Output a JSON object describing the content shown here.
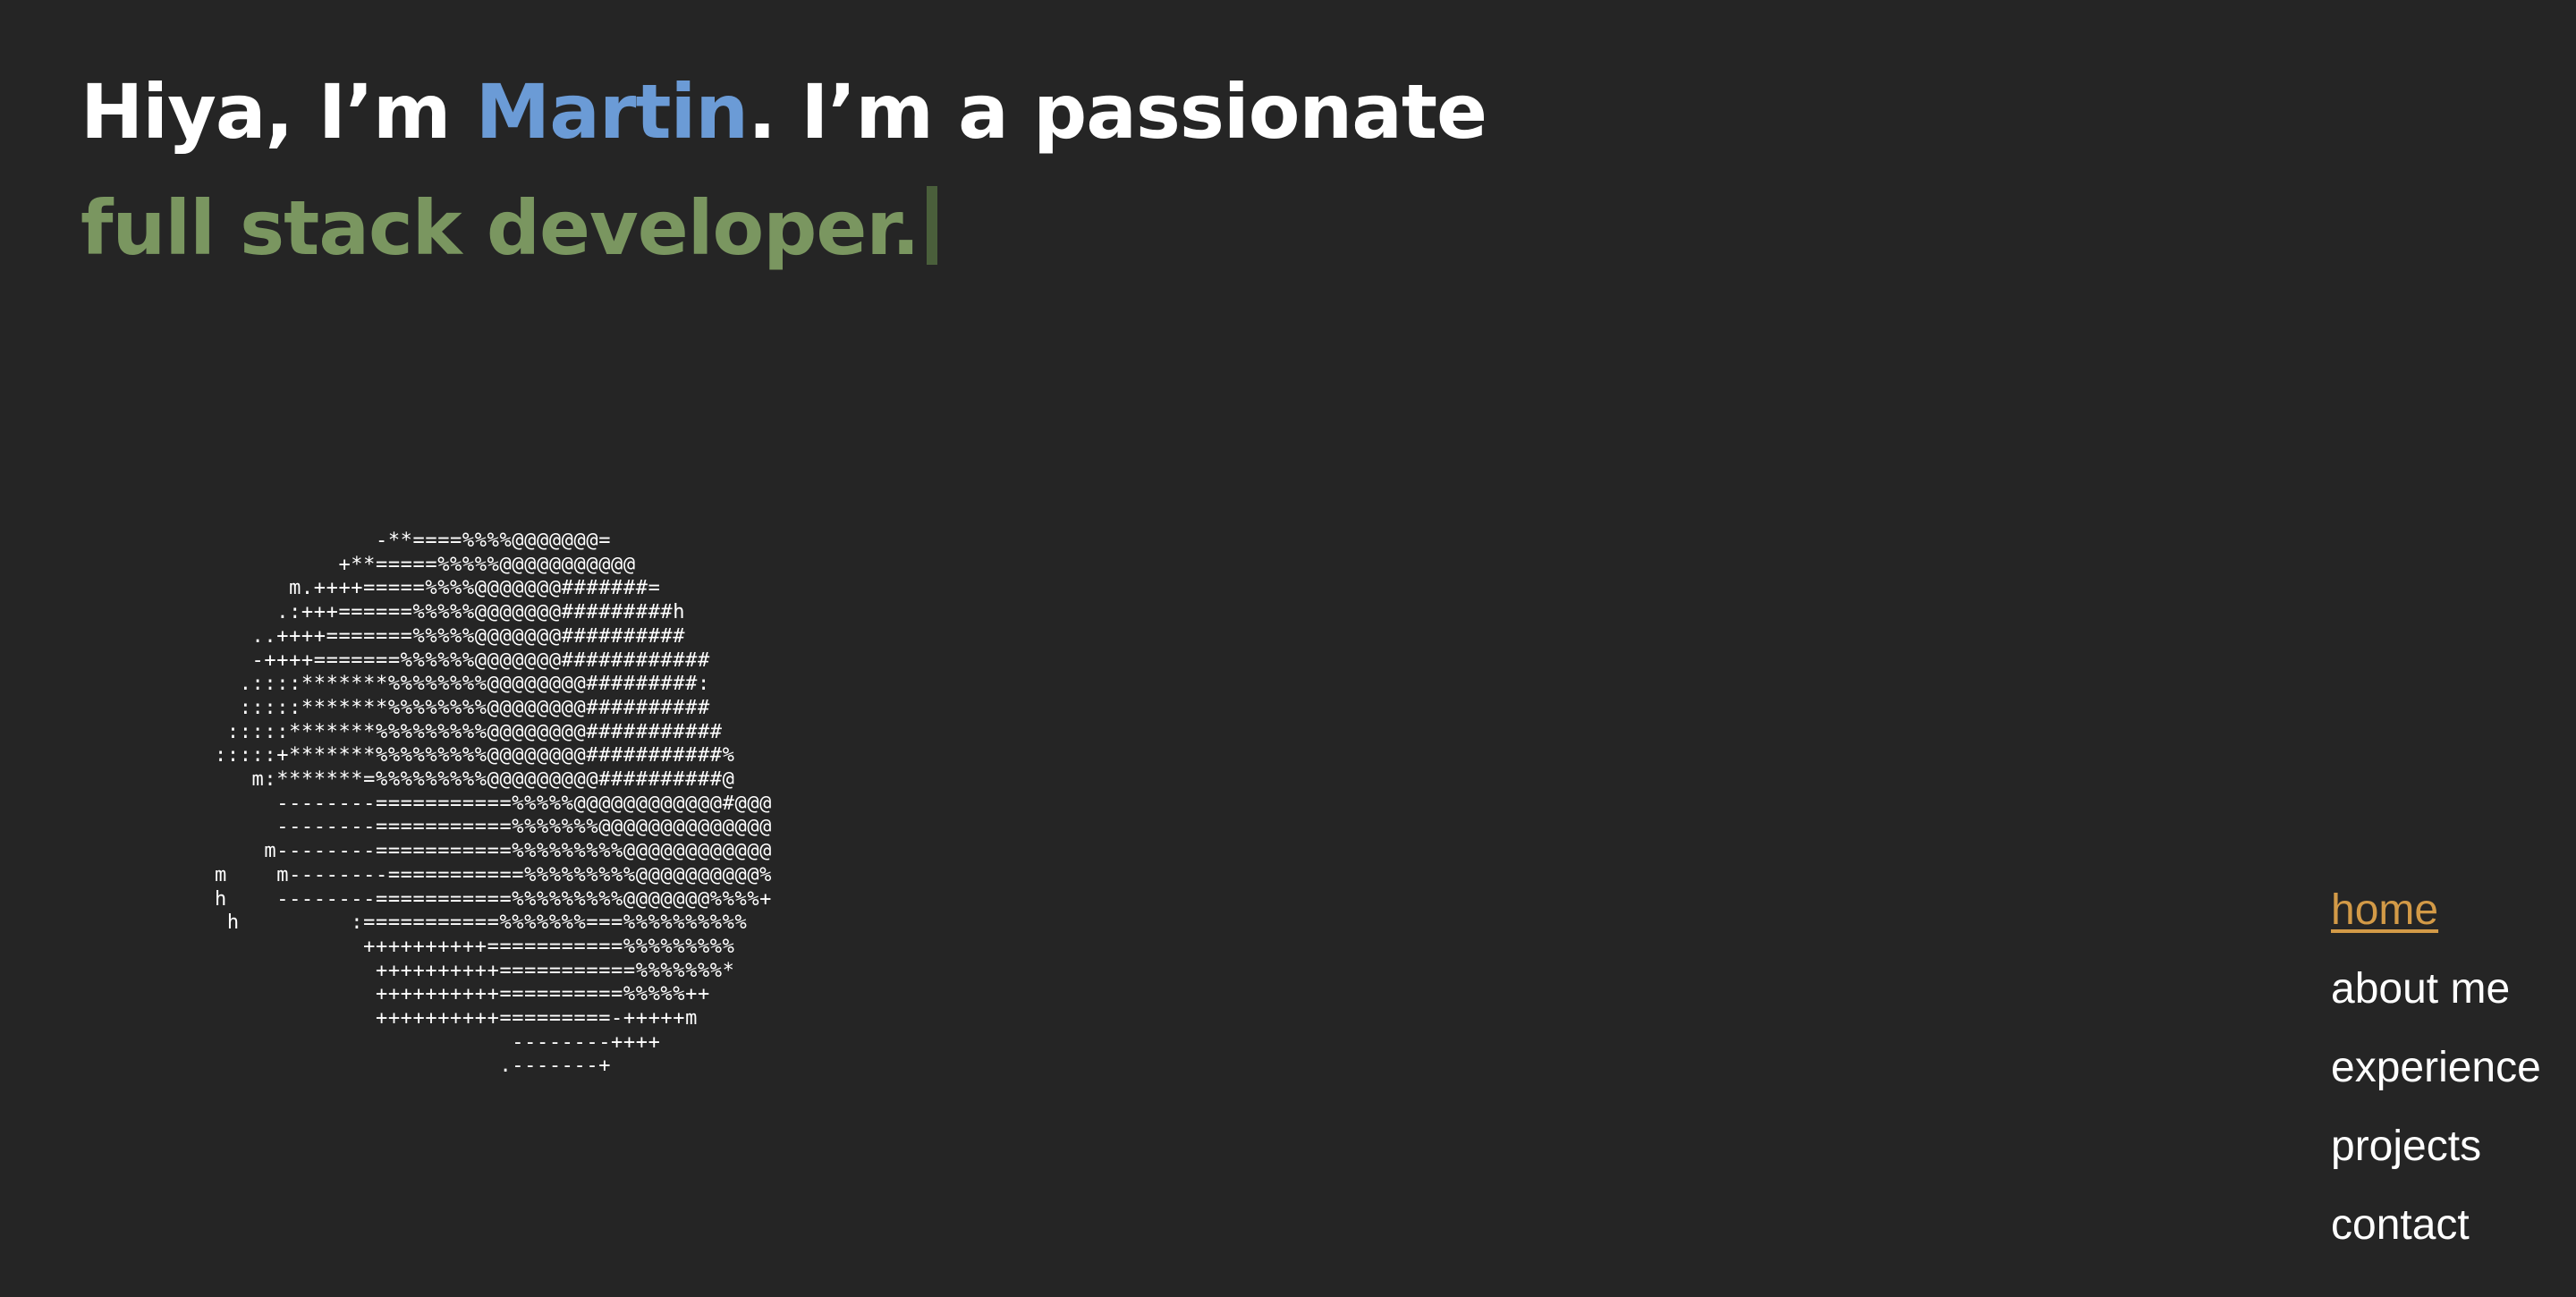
{
  "hero": {
    "line1_prefix": "Hiya, I’m ",
    "name": "Martin",
    "line1_suffix": ". I’m a passionate",
    "role": "full stack developer."
  },
  "ascii_art": "             -**====%%%%@@@@@@@=\n          +**=====%%%%%@@@@@@@@@@@\n      m.++++=====%%%%@@@@@@@#######=\n     .:+++======%%%%%@@@@@@@#########h\n   ..++++=======%%%%%@@@@@@@##########\n   -++++=======%%%%%%@@@@@@@############\n  .::::*******%%%%%%%%@@@@@@@@#########:\n  :::::*******%%%%%%%%@@@@@@@@##########\n :::::*******%%%%%%%%%@@@@@@@@###########\n:::::+*******%%%%%%%%%@@@@@@@@###########%\n   m:*******=%%%%%%%%%@@@@@@@@@##########@\n     --------===========%%%%%@@@@@@@@@@@@#@@@\n     --------===========%%%%%%%@@@@@@@@@@@@@@\n    m--------===========%%%%%%%%%@@@@@@@@@@@@\nm    m--------===========%%%%%%%%%@@@@@@@@@@%\nh    --------===========%%%%%%%%%@@@@@@@%%%%+\n h         :===========%%%%%%%===%%%%%%%%%%\n            ++++++++++===========%%%%%%%%%\n             ++++++++++===========%%%%%%%*\n             ++++++++++==========%%%%%++\n             ++++++++++=========-+++++m\n                        --------++++\n                       .-------+",
  "nav": {
    "items": [
      {
        "label": "home",
        "active": true
      },
      {
        "label": "about me",
        "active": false
      },
      {
        "label": "experience",
        "active": false
      },
      {
        "label": "projects",
        "active": false
      },
      {
        "label": "contact",
        "active": false
      }
    ]
  },
  "colors": {
    "background": "#252525",
    "text": "#ffffff",
    "name_accent": "#6b9bd6",
    "role_accent": "#7a9660",
    "cursor": "#4a5f3b",
    "nav_active": "#d39a47"
  }
}
